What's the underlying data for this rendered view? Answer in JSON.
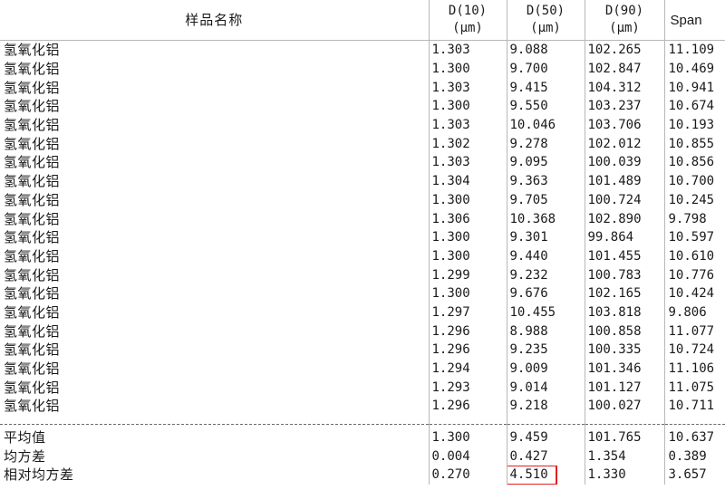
{
  "header": {
    "name": "样品名称",
    "d10": [
      "D(10)",
      "(μm)"
    ],
    "d50": [
      "D(50)",
      "(μm)"
    ],
    "d90": [
      "D(90)",
      "(μm)"
    ],
    "span": "Span"
  },
  "rows": [
    {
      "name": "氢氧化铝",
      "d10": "1.303",
      "d50": "9.088",
      "d90": "102.265",
      "span": "11.109"
    },
    {
      "name": "氢氧化铝",
      "d10": "1.300",
      "d50": "9.700",
      "d90": "102.847",
      "span": "10.469"
    },
    {
      "name": "氢氧化铝",
      "d10": "1.303",
      "d50": "9.415",
      "d90": "104.312",
      "span": "10.941"
    },
    {
      "name": "氢氧化铝",
      "d10": "1.300",
      "d50": "9.550",
      "d90": "103.237",
      "span": "10.674"
    },
    {
      "name": "氢氧化铝",
      "d10": "1.303",
      "d50": "10.046",
      "d90": "103.706",
      "span": "10.193"
    },
    {
      "name": "氢氧化铝",
      "d10": "1.302",
      "d50": "9.278",
      "d90": "102.012",
      "span": "10.855"
    },
    {
      "name": "氢氧化铝",
      "d10": "1.303",
      "d50": "9.095",
      "d90": "100.039",
      "span": "10.856"
    },
    {
      "name": "氢氧化铝",
      "d10": "1.304",
      "d50": "9.363",
      "d90": "101.489",
      "span": "10.700"
    },
    {
      "name": "氢氧化铝",
      "d10": "1.300",
      "d50": "9.705",
      "d90": "100.724",
      "span": "10.245"
    },
    {
      "name": "氢氧化铝",
      "d10": "1.306",
      "d50": "10.368",
      "d90": "102.890",
      "span": "9.798"
    },
    {
      "name": "氢氧化铝",
      "d10": "1.300",
      "d50": "9.301",
      "d90": "99.864",
      "span": "10.597"
    },
    {
      "name": "氢氧化铝",
      "d10": "1.300",
      "d50": "9.440",
      "d90": "101.455",
      "span": "10.610"
    },
    {
      "name": "氢氧化铝",
      "d10": "1.299",
      "d50": "9.232",
      "d90": "100.783",
      "span": "10.776"
    },
    {
      "name": "氢氧化铝",
      "d10": "1.300",
      "d50": "9.676",
      "d90": "102.165",
      "span": "10.424"
    },
    {
      "name": "氢氧化铝",
      "d10": "1.297",
      "d50": "10.455",
      "d90": "103.818",
      "span": "9.806"
    },
    {
      "name": "氢氧化铝",
      "d10": "1.296",
      "d50": "8.988",
      "d90": "100.858",
      "span": "11.077"
    },
    {
      "name": "氢氧化铝",
      "d10": "1.296",
      "d50": "9.235",
      "d90": "100.335",
      "span": "10.724"
    },
    {
      "name": "氢氧化铝",
      "d10": "1.294",
      "d50": "9.009",
      "d90": "101.346",
      "span": "11.106"
    },
    {
      "name": "氢氧化铝",
      "d10": "1.293",
      "d50": "9.014",
      "d90": "101.127",
      "span": "11.075"
    },
    {
      "name": "氢氧化铝",
      "d10": "1.296",
      "d50": "9.218",
      "d90": "100.027",
      "span": "10.711"
    }
  ],
  "stats": [
    {
      "name": "平均值",
      "d10": "1.300",
      "d50": "9.459",
      "d90": "101.765",
      "span": "10.637"
    },
    {
      "name": "均方差",
      "d10": "0.004",
      "d50": "0.427",
      "d90": "1.354",
      "span": "0.389"
    },
    {
      "name": "相对均方差",
      "d10": "0.270",
      "d50": "4.510",
      "d90": "1.330",
      "span": "3.657"
    }
  ],
  "highlight_color": "#e02020"
}
